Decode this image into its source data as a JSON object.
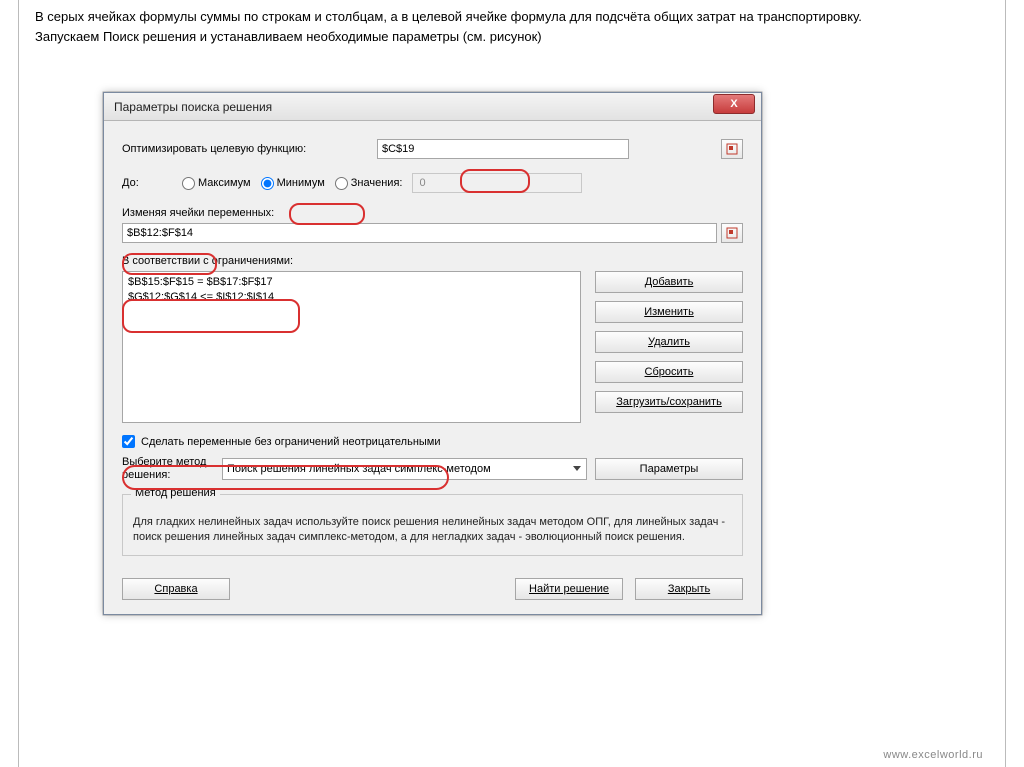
{
  "intro": {
    "line1": "В серых ячейках формулы суммы по строкам и столбцам, а в целевой ячейке формула для подсчёта общих затрат на транспортировку.",
    "line2": "Запускаем Поиск решения и устанавливаем необходимые параметры (см. рисунок)"
  },
  "dialog": {
    "title": "Параметры поиска решения",
    "close": "X",
    "objective_label": "Оптимизировать целевую функцию:",
    "objective_value": "$C$19",
    "to_label": "До:",
    "radio_max": "Максимум",
    "radio_min": "Минимум",
    "radio_val": "Значения:",
    "value_input": "0",
    "vars_label": "Изменяя ячейки переменных:",
    "vars_value": "$B$12:$F$14",
    "constraints_label": "В соответствии с ограничениями:",
    "constraints": [
      "$B$15:$F$15 = $B$17:$F$17",
      "$G$12:$G$14 <= $I$12:$I$14"
    ],
    "btn_add": "Добавить",
    "btn_change": "Изменить",
    "btn_delete": "Удалить",
    "btn_reset": "Сбросить",
    "btn_loadsave": "Загрузить/сохранить",
    "checkbox_label": "Сделать переменные без ограничений неотрицательными",
    "method_label": "Выберите метод решения:",
    "method_value": "Поиск решения линейных задач симплекс-методом",
    "btn_params": "Параметры",
    "group_title": "Метод решения",
    "group_text": "Для гладких нелинейных задач используйте поиск решения нелинейных задач методом ОПГ, для линейных задач - поиск решения линейных задач симплекс-методом, а для негладких задач - эволюционный поиск решения.",
    "btn_help": "Справка",
    "btn_solve": "Найти решение",
    "btn_close": "Закрыть"
  },
  "footer": "www.excelworld.ru"
}
